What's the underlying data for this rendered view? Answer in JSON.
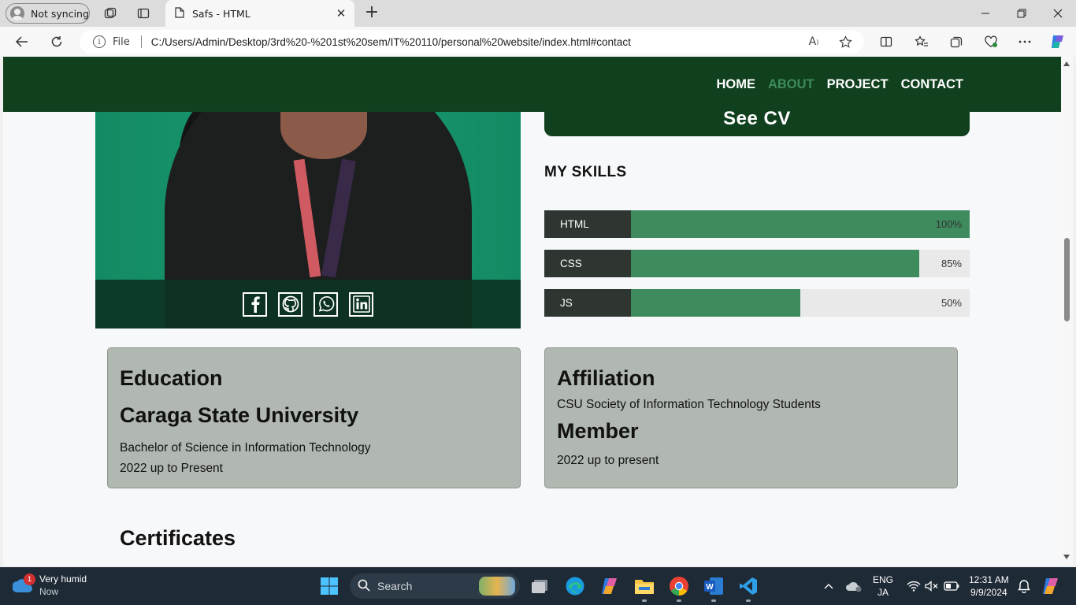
{
  "browser": {
    "profile_label": "Not syncing",
    "tab_title": "Safs - HTML",
    "file_label": "File",
    "url": "C:/Users/Admin/Desktop/3rd%20-%201st%20sem/IT%20110/personal%20website/index.html#contact"
  },
  "site": {
    "nav": [
      "HOME",
      "ABOUT",
      "PROJECT",
      "CONTACT"
    ],
    "nav_active": "ABOUT",
    "cv_button": "See CV",
    "skills_title": "MY SKILLS",
    "skills": [
      {
        "name": "HTML",
        "percent_label": "100%",
        "level": 1.0
      },
      {
        "name": "CSS",
        "percent_label": "85%",
        "level": 0.85
      },
      {
        "name": "JS",
        "percent_label": "50%",
        "level": 0.5
      }
    ],
    "social_icons": [
      "facebook-icon",
      "github-icon",
      "whatsapp-icon",
      "linkedin-icon"
    ],
    "education": {
      "heading": "Education",
      "school": "Caraga State University",
      "degree": "Bachelor of Science in Information Technology",
      "years": "2022 up to Present"
    },
    "affiliation": {
      "heading": "Affiliation",
      "organization": "CSU Society of Information Technology Students",
      "role": "Member",
      "years": "2022 up to present"
    },
    "certificates_title": "Certificates"
  },
  "taskbar": {
    "weather_title": "Very humid",
    "weather_sub": "Now",
    "notification_count": "1",
    "search_placeholder": "Search",
    "lang_line1": "ENG",
    "lang_line2": "JA",
    "time": "12:31 AM",
    "date": "9/9/2024"
  },
  "colors": {
    "nav_bg": "#11401f",
    "accent_green": "#3e8b5e",
    "card_bg": "#b1b8b1",
    "taskbar_bg": "#1e2a36"
  }
}
